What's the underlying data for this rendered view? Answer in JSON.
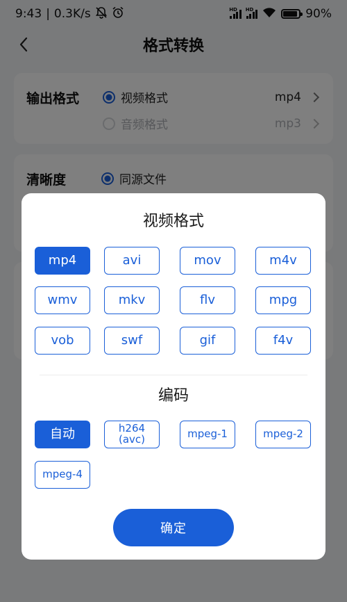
{
  "status": {
    "time": "9:43",
    "speed": "0.3K/s",
    "battery": "90%",
    "battery_level": 0.9,
    "hd_label": "HD"
  },
  "header": {
    "title": "格式转换"
  },
  "settings": {
    "output_label": "输出格式",
    "output_options": [
      {
        "label": "视频格式",
        "value": "mp4",
        "selected": true
      },
      {
        "label": "音频格式",
        "value": "mp3",
        "selected": false
      }
    ],
    "resolution_label": "清晰度",
    "resolution_option": "同源文件"
  },
  "dialog": {
    "video_title": "视频格式",
    "formats": [
      "mp4",
      "avi",
      "mov",
      "m4v",
      "wmv",
      "mkv",
      "flv",
      "mpg",
      "vob",
      "swf",
      "gif",
      "f4v"
    ],
    "selected_format": "mp4",
    "codec_title": "编码",
    "codecs": [
      "自动",
      "h264\n(avc)",
      "mpeg-1",
      "mpeg-2",
      "mpeg-4"
    ],
    "selected_codec": "自动",
    "confirm_label": "确定"
  },
  "colors": {
    "accent": "#1a5fd8",
    "overlay": "rgba(0,0,0,0.5)"
  },
  "icons": [
    "mute-bell-icon",
    "alarm-icon",
    "signal-icon",
    "wifi-icon",
    "battery-icon",
    "back-arrow-icon",
    "chevron-right-icon"
  ]
}
